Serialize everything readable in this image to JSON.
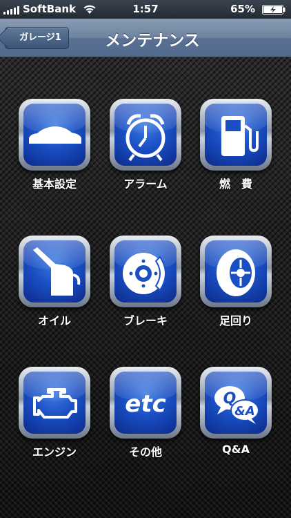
{
  "status_bar": {
    "carrier": "SoftBank",
    "time": "1:57",
    "battery": "65%"
  },
  "nav": {
    "back_label": "ガレージ1",
    "title": "メンテナンス"
  },
  "tiles": [
    {
      "label": "基本設定",
      "icon": "car-icon"
    },
    {
      "label": "アラーム",
      "icon": "alarm-clock-icon"
    },
    {
      "label": "燃　費",
      "icon": "fuel-pump-icon"
    },
    {
      "label": "オイル",
      "icon": "oil-can-icon"
    },
    {
      "label": "ブレーキ",
      "icon": "brake-disc-icon"
    },
    {
      "label": "足回り",
      "icon": "tire-icon"
    },
    {
      "label": "エンジン",
      "icon": "engine-icon"
    },
    {
      "label": "その他",
      "icon": "etc-icon",
      "icon_text": "etc"
    },
    {
      "label": "Q&A",
      "icon": "qa-bubbles-icon",
      "icon_text_q": "Q",
      "icon_text_a": "&A"
    }
  ],
  "colors": {
    "nav": "#6d83a0",
    "tile_blue": "#1a4fc4"
  }
}
